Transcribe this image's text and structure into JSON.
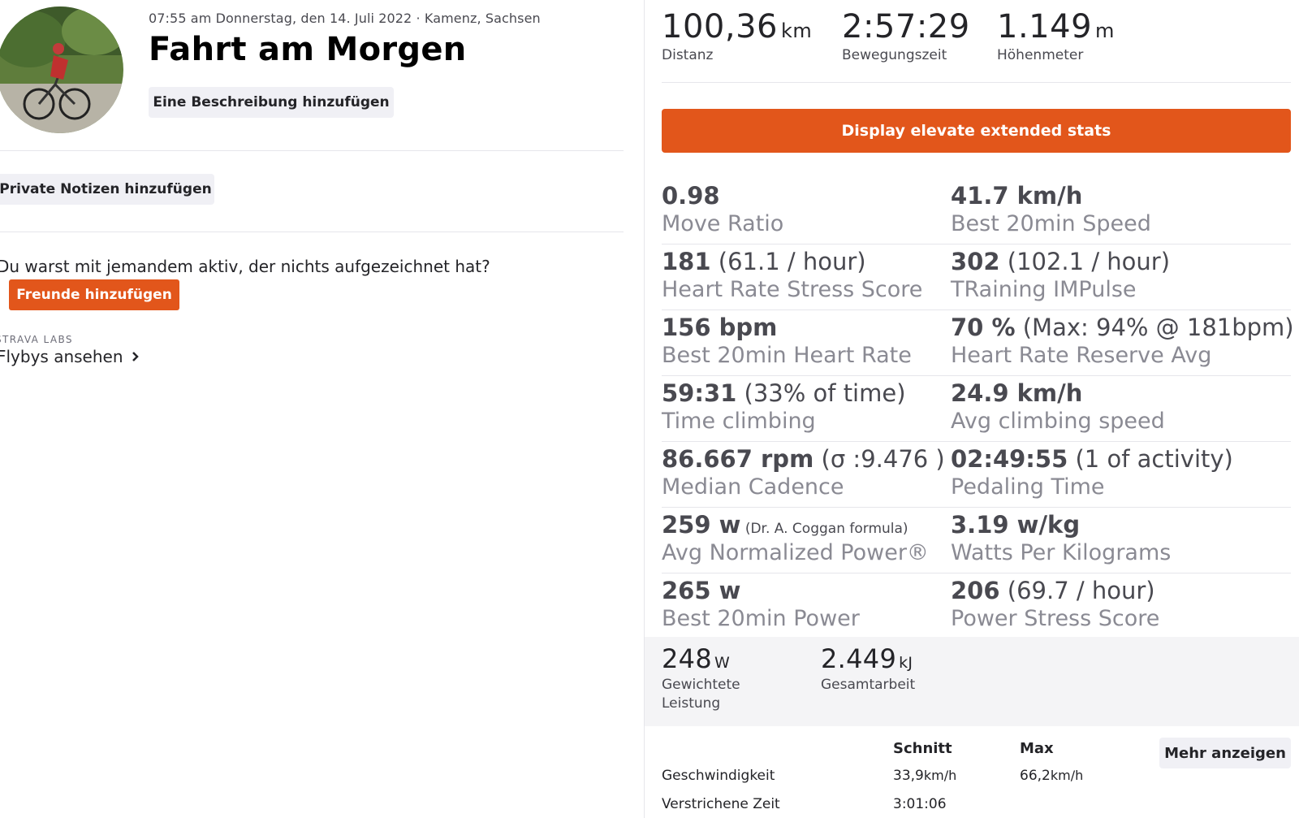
{
  "header": {
    "meta": "07:55 am Donnerstag, den 14. Juli 2022 · Kamenz, Sachsen",
    "title": "Fahrt am Morgen",
    "add_description": "Eine Beschreibung hinzufügen"
  },
  "private_notes_button": "Private Notizen hinzufügen",
  "friends": {
    "question": "Du warst mit jemandem aktiv, der nichts aufgezeichnet hat?",
    "button": "Freunde hinzufügen"
  },
  "labs": {
    "label": "STRAVA LABS",
    "flybys": "Flybys ansehen"
  },
  "top_stats": [
    {
      "value": "100,36",
      "unit": "km",
      "label": "Distanz"
    },
    {
      "value": "2:57:29",
      "unit": "",
      "label": "Bewegungszeit"
    },
    {
      "value": "1.149",
      "unit": "m",
      "label": "Höhenmeter"
    }
  ],
  "elevate_button": "Display elevate extended stats",
  "extended_stats": [
    [
      {
        "value": "0.98",
        "extra": "",
        "small": "",
        "label": "Move Ratio"
      },
      {
        "value": "41.7 km/h",
        "extra": "",
        "small": "",
        "label": "Best 20min Speed"
      }
    ],
    [
      {
        "value": "181",
        "extra": " (61.1 / hour)",
        "small": "",
        "label": "Heart Rate Stress Score"
      },
      {
        "value": "302",
        "extra": " (102.1 / hour)",
        "small": "",
        "label": "TRaining IMPulse"
      }
    ],
    [
      {
        "value": "156 bpm",
        "extra": "",
        "small": "",
        "label": "Best 20min Heart Rate"
      },
      {
        "value": "70 %",
        "extra": " (Max: 94% @ 181bpm)",
        "small": "",
        "label": "Heart Rate Reserve Avg"
      }
    ],
    [
      {
        "value": "59:31",
        "extra": " (33% of time)",
        "small": "",
        "label": "Time climbing"
      },
      {
        "value": "24.9 km/h",
        "extra": "",
        "small": "",
        "label": "Avg climbing speed"
      }
    ],
    [
      {
        "value": "86.667 rpm",
        "extra": " (σ :9.476 )",
        "small": "",
        "label": "Median Cadence"
      },
      {
        "value": "02:49:55",
        "extra": " (1 of activity)",
        "small": "",
        "label": "Pedaling Time"
      }
    ],
    [
      {
        "value": "259 w",
        "extra": "",
        "small": " (Dr. A. Coggan formula)",
        "label": "Avg Normalized Power®"
      },
      {
        "value": "3.19 w/kg",
        "extra": "",
        "small": "",
        "label": "Watts Per Kilograms"
      }
    ],
    [
      {
        "value": "265 w",
        "extra": "",
        "small": "",
        "label": "Best 20min Power"
      },
      {
        "value": "206",
        "extra": " (69.7 / hour)",
        "small": "",
        "label": "Power Stress Score"
      }
    ]
  ],
  "power_panel": [
    {
      "value": "248",
      "unit": "W",
      "label_line1": "Gewichtete",
      "label_line2": "Leistung"
    },
    {
      "value": "2.449",
      "unit": "kJ",
      "label_line1": "Gesamtarbeit",
      "label_line2": ""
    }
  ],
  "summary_table": {
    "headers": [
      "Schnitt",
      "Max"
    ],
    "rows": [
      {
        "label": "Geschwindigkeit",
        "avg": "33,9",
        "avg_unit": "km/h",
        "max": "66,2",
        "max_unit": "km/h"
      },
      {
        "label": "Verstrichene Zeit",
        "avg": "3:01:06",
        "avg_unit": "",
        "max": "",
        "max_unit": ""
      }
    ],
    "more_button": "Mehr anzeigen"
  },
  "colors": {
    "accent": "#e2561b",
    "stat_value": "#494950",
    "stat_label": "#8a8a93",
    "panel_bg": "#f4f4f6"
  }
}
